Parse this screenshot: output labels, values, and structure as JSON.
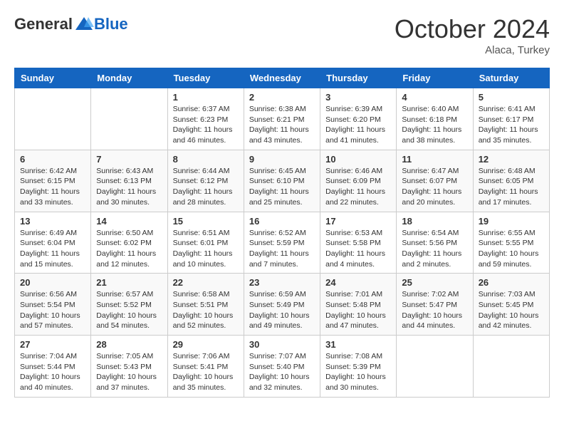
{
  "logo": {
    "general": "General",
    "blue": "Blue"
  },
  "header": {
    "month_title": "October 2024",
    "subtitle": "Alaca, Turkey"
  },
  "days_of_week": [
    "Sunday",
    "Monday",
    "Tuesday",
    "Wednesday",
    "Thursday",
    "Friday",
    "Saturday"
  ],
  "weeks": [
    [
      {
        "day": null,
        "info": null
      },
      {
        "day": null,
        "info": null
      },
      {
        "day": "1",
        "sunrise": "6:37 AM",
        "sunset": "6:23 PM",
        "daylight": "11 hours and 46 minutes."
      },
      {
        "day": "2",
        "sunrise": "6:38 AM",
        "sunset": "6:21 PM",
        "daylight": "11 hours and 43 minutes."
      },
      {
        "day": "3",
        "sunrise": "6:39 AM",
        "sunset": "6:20 PM",
        "daylight": "11 hours and 41 minutes."
      },
      {
        "day": "4",
        "sunrise": "6:40 AM",
        "sunset": "6:18 PM",
        "daylight": "11 hours and 38 minutes."
      },
      {
        "day": "5",
        "sunrise": "6:41 AM",
        "sunset": "6:17 PM",
        "daylight": "11 hours and 35 minutes."
      }
    ],
    [
      {
        "day": "6",
        "sunrise": "6:42 AM",
        "sunset": "6:15 PM",
        "daylight": "11 hours and 33 minutes."
      },
      {
        "day": "7",
        "sunrise": "6:43 AM",
        "sunset": "6:13 PM",
        "daylight": "11 hours and 30 minutes."
      },
      {
        "day": "8",
        "sunrise": "6:44 AM",
        "sunset": "6:12 PM",
        "daylight": "11 hours and 28 minutes."
      },
      {
        "day": "9",
        "sunrise": "6:45 AM",
        "sunset": "6:10 PM",
        "daylight": "11 hours and 25 minutes."
      },
      {
        "day": "10",
        "sunrise": "6:46 AM",
        "sunset": "6:09 PM",
        "daylight": "11 hours and 22 minutes."
      },
      {
        "day": "11",
        "sunrise": "6:47 AM",
        "sunset": "6:07 PM",
        "daylight": "11 hours and 20 minutes."
      },
      {
        "day": "12",
        "sunrise": "6:48 AM",
        "sunset": "6:05 PM",
        "daylight": "11 hours and 17 minutes."
      }
    ],
    [
      {
        "day": "13",
        "sunrise": "6:49 AM",
        "sunset": "6:04 PM",
        "daylight": "11 hours and 15 minutes."
      },
      {
        "day": "14",
        "sunrise": "6:50 AM",
        "sunset": "6:02 PM",
        "daylight": "11 hours and 12 minutes."
      },
      {
        "day": "15",
        "sunrise": "6:51 AM",
        "sunset": "6:01 PM",
        "daylight": "11 hours and 10 minutes."
      },
      {
        "day": "16",
        "sunrise": "6:52 AM",
        "sunset": "5:59 PM",
        "daylight": "11 hours and 7 minutes."
      },
      {
        "day": "17",
        "sunrise": "6:53 AM",
        "sunset": "5:58 PM",
        "daylight": "11 hours and 4 minutes."
      },
      {
        "day": "18",
        "sunrise": "6:54 AM",
        "sunset": "5:56 PM",
        "daylight": "11 hours and 2 minutes."
      },
      {
        "day": "19",
        "sunrise": "6:55 AM",
        "sunset": "5:55 PM",
        "daylight": "10 hours and 59 minutes."
      }
    ],
    [
      {
        "day": "20",
        "sunrise": "6:56 AM",
        "sunset": "5:54 PM",
        "daylight": "10 hours and 57 minutes."
      },
      {
        "day": "21",
        "sunrise": "6:57 AM",
        "sunset": "5:52 PM",
        "daylight": "10 hours and 54 minutes."
      },
      {
        "day": "22",
        "sunrise": "6:58 AM",
        "sunset": "5:51 PM",
        "daylight": "10 hours and 52 minutes."
      },
      {
        "day": "23",
        "sunrise": "6:59 AM",
        "sunset": "5:49 PM",
        "daylight": "10 hours and 49 minutes."
      },
      {
        "day": "24",
        "sunrise": "7:01 AM",
        "sunset": "5:48 PM",
        "daylight": "10 hours and 47 minutes."
      },
      {
        "day": "25",
        "sunrise": "7:02 AM",
        "sunset": "5:47 PM",
        "daylight": "10 hours and 44 minutes."
      },
      {
        "day": "26",
        "sunrise": "7:03 AM",
        "sunset": "5:45 PM",
        "daylight": "10 hours and 42 minutes."
      }
    ],
    [
      {
        "day": "27",
        "sunrise": "7:04 AM",
        "sunset": "5:44 PM",
        "daylight": "10 hours and 40 minutes."
      },
      {
        "day": "28",
        "sunrise": "7:05 AM",
        "sunset": "5:43 PM",
        "daylight": "10 hours and 37 minutes."
      },
      {
        "day": "29",
        "sunrise": "7:06 AM",
        "sunset": "5:41 PM",
        "daylight": "10 hours and 35 minutes."
      },
      {
        "day": "30",
        "sunrise": "7:07 AM",
        "sunset": "5:40 PM",
        "daylight": "10 hours and 32 minutes."
      },
      {
        "day": "31",
        "sunrise": "7:08 AM",
        "sunset": "5:39 PM",
        "daylight": "10 hours and 30 minutes."
      },
      {
        "day": null,
        "info": null
      },
      {
        "day": null,
        "info": null
      }
    ]
  ],
  "labels": {
    "sunrise": "Sunrise:",
    "sunset": "Sunset:",
    "daylight": "Daylight:"
  }
}
